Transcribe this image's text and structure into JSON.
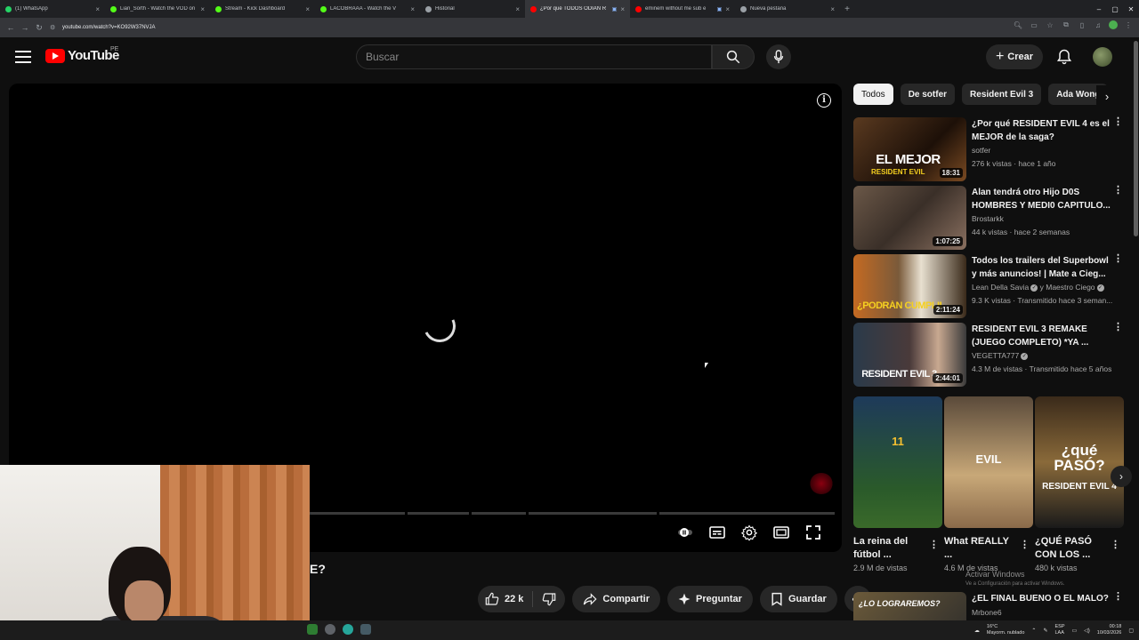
{
  "browser": {
    "tabs": [
      {
        "title": "(1) WhatsApp",
        "color": "#25d366",
        "active": false
      },
      {
        "title": "Lian_Sorth - Watch the VOD on",
        "color": "#53fc18",
        "active": false
      },
      {
        "title": "Stream - Kick Dashboard",
        "color": "#53fc18",
        "active": false
      },
      {
        "title": "LACOBRAAA - Watch the V",
        "color": "#53fc18",
        "active": false
      },
      {
        "title": "Historial",
        "color": "#9aa0a6",
        "active": false
      },
      {
        "title": "¿Por qué TODOS ODIAN R",
        "color": "#ff0000",
        "active": true
      },
      {
        "title": "eminem without me sub e",
        "color": "#ff0000",
        "active": false
      },
      {
        "title": "Nueva pestaña",
        "color": "#9aa0a6",
        "active": false
      }
    ],
    "new_tab": "+",
    "url": "youtube.com/watch?v=KO92W37NVJA"
  },
  "youtube": {
    "logo_text": "YouTube",
    "country_code": "PE",
    "search_placeholder": "Buscar",
    "create_label": "Crear"
  },
  "video": {
    "title_fragment": "E?",
    "like_count": "22 k",
    "share_label": "Compartir",
    "ask_label": "Preguntar",
    "save_label": "Guardar",
    "more": "•••"
  },
  "chips": [
    "Todos",
    "De sotfer",
    "Resident Evil 3",
    "Ada Wong"
  ],
  "recommendations": [
    {
      "title": "¿Por qué RESIDENT EVIL 4 es el MEJOR de la saga?",
      "channel": "sotfer",
      "meta": "276 k vistas · hace 1 año",
      "duration": "18:31",
      "thumb_text": "EL MEJOR",
      "thumb_sub": "RESIDENT EVIL",
      "verified": false
    },
    {
      "title": "Alan tendrá otro Hijo D0S HOMBRES Y MEDI0 CAPITULO...",
      "channel": "Brostarkk",
      "meta": "44 k vistas · hace 2 semanas",
      "duration": "1:07:25",
      "thumb_text": "",
      "thumb_sub": "",
      "verified": false
    },
    {
      "title": "Todos los trailers del Superbowl y más anuncios! | Mate a Cieg...",
      "channel": "Lean Della Savia",
      "channel2": "y Maestro Ciego",
      "meta": "9.3 K vistas · Transmitido hace 3 seman...",
      "duration": "2:11:24",
      "thumb_text": "¿PODRÁN CUMPLIR?",
      "thumb_sub": "",
      "verified": true
    },
    {
      "title": "RESIDENT EVIL 3 REMAKE (JUEGO COMPLETO) *YA ...",
      "channel": "VEGETTA777",
      "meta": "4.3 M de vistas · Transmitido hace 5 años",
      "duration": "2:44:01",
      "thumb_text": "RESIDENT EVIL 3",
      "thumb_sub": "",
      "verified": true
    }
  ],
  "shorts": [
    {
      "title": "La reina del fútbol ...",
      "views": "2.9 M de vistas",
      "thumb_text": "11"
    },
    {
      "title": "What REALLY ...",
      "views": "4.6 M de vistas",
      "thumb_text": "EVIL"
    },
    {
      "title": "¿QUÉ PASÓ CON LOS ...",
      "views": "480 k vistas",
      "thumb_text": "¿qué PASÓ?",
      "thumb_sub": "RESIDENT EVIL 4"
    }
  ],
  "next_rec": {
    "title": "¿EL FINAL BUENO O EL MALO?",
    "channel": "Mrbone6",
    "thumb_text": "¿LO LOGRAREMOS?"
  },
  "windows_watermark": {
    "line1": "Activar Windows",
    "line2": "Ve a Configuración para activar Windows."
  },
  "taskbar": {
    "temp": "16°C",
    "weather": "Mayorm. nublado",
    "lang1": "ESP",
    "lang2": "LAA",
    "time": "00:18",
    "date": "10/03/2026"
  }
}
